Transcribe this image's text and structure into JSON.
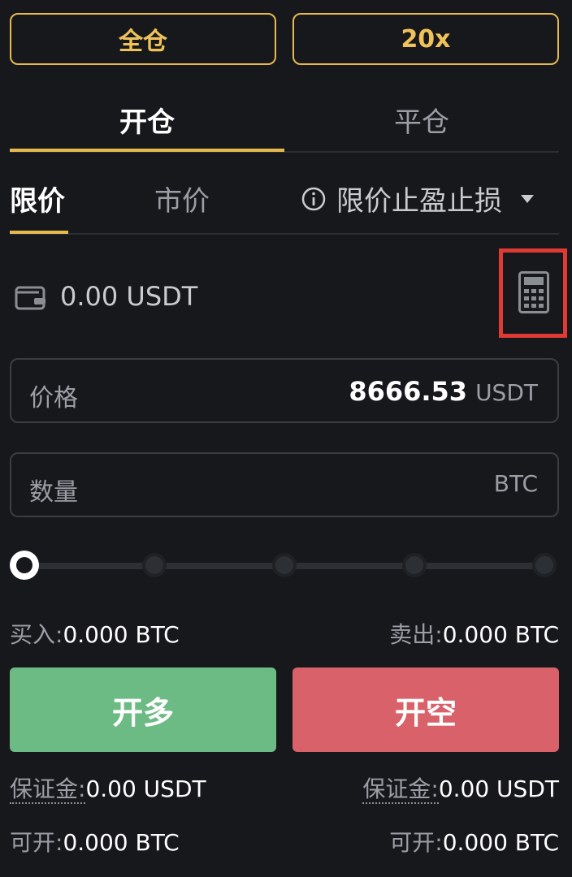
{
  "header": {
    "margin_mode_label": "全仓",
    "leverage_label": "20x"
  },
  "position_tabs": [
    {
      "label": "开仓",
      "active": true
    },
    {
      "label": "平仓",
      "active": false
    }
  ],
  "order_types": [
    {
      "label": "限价",
      "active": true
    },
    {
      "label": "市价",
      "active": false
    },
    {
      "label": "限价止盈止损",
      "active": false,
      "has_info_icon": true,
      "has_dropdown": true
    }
  ],
  "balance": {
    "text": "0.00 USDT"
  },
  "price_field": {
    "label": "价格",
    "value": "8666.53",
    "unit": "USDT"
  },
  "quantity_field": {
    "label": "数量",
    "value": "",
    "unit": "BTC"
  },
  "slider": {
    "value_fraction": 0,
    "steps": 5
  },
  "summary": {
    "buy_label": "买入:",
    "buy_value": "0.000 BTC",
    "sell_label": "卖出:",
    "sell_value": "0.000 BTC"
  },
  "actions": {
    "long_label": "开多",
    "short_label": "开空"
  },
  "margin": {
    "left_label": "保证金:",
    "left_value": "0.00 USDT",
    "right_label": "保证金:",
    "right_value": "0.00 USDT"
  },
  "available": {
    "left_label": "可开:",
    "left_value": "0.000 BTC",
    "right_label": "可开:",
    "right_value": "0.000 BTC"
  },
  "colors": {
    "accent": "#e6b94f",
    "long": "#6dbb84",
    "short": "#d9616a",
    "highlight_box": "#e03a34"
  },
  "icons": {
    "wallet": "wallet-icon",
    "calculator": "calculator-icon",
    "info": "info-icon",
    "dropdown": "caret-down-icon"
  }
}
